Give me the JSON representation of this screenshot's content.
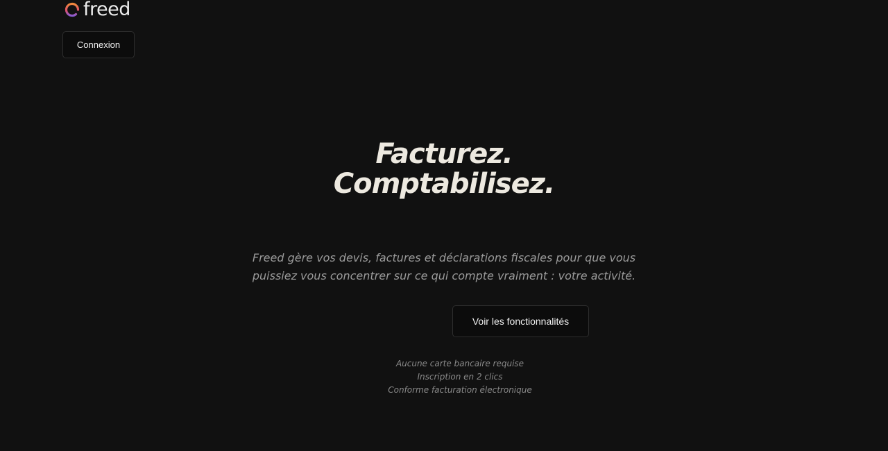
{
  "brand": {
    "name": "freed",
    "logo_icon": "freed-logo-icon",
    "logo_colors": [
      "#f08a3c",
      "#e0506a",
      "#8a5cd0"
    ]
  },
  "header": {
    "login_label": "Connexion"
  },
  "hero": {
    "title_line1": "Facturez.",
    "title_line2": "Comptabilisez.",
    "description": "Freed gère vos devis, factures et déclarations fiscales pour que vous puissiez vous concentrer sur ce qui compte vraiment : votre activité.",
    "features_label": "Voir les fonctionnalités"
  },
  "perks": [
    "Aucune carte bancaire requise",
    "Inscription en 2 clics",
    "Conforme facturation électronique"
  ],
  "colors": {
    "background": "#111111",
    "title": "#ede9e0",
    "muted_text": "#9a9a9a"
  }
}
